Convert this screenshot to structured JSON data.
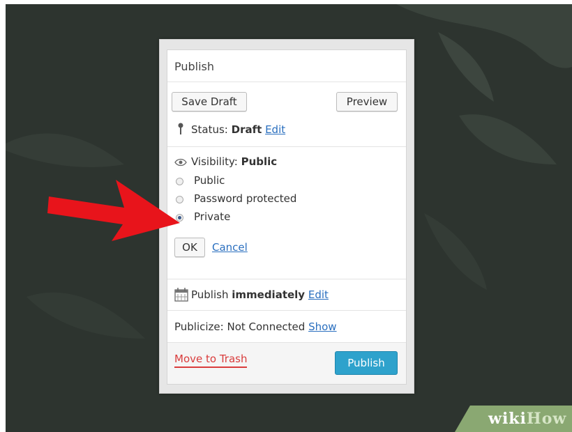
{
  "panel": {
    "title": "Publish",
    "save_draft_label": "Save Draft",
    "preview_label": "Preview",
    "status_label": "Status: ",
    "status_value": "Draft",
    "status_edit": "Edit",
    "visibility_label": "Visibility: ",
    "visibility_value": "Public",
    "options": [
      {
        "label": "Public",
        "selected": false
      },
      {
        "label": "Password protected",
        "selected": false
      },
      {
        "label": "Private",
        "selected": true
      }
    ],
    "ok_label": "OK",
    "cancel_label": "Cancel",
    "publish_prefix": "Publish ",
    "publish_when": "immediately",
    "publish_edit": "Edit",
    "publicize_text": "Publicize: Not Connected ",
    "publicize_show": "Show",
    "trash_label": "Move to Trash",
    "publish_button": "Publish"
  },
  "watermark": {
    "wiki": "wiki",
    "how": "How"
  },
  "colors": {
    "background": "#2d342f",
    "arrow": "#e8141b",
    "publish_button": "#2ea2cc",
    "trash_link": "#d93c3c",
    "link": "#2a6fbf"
  }
}
